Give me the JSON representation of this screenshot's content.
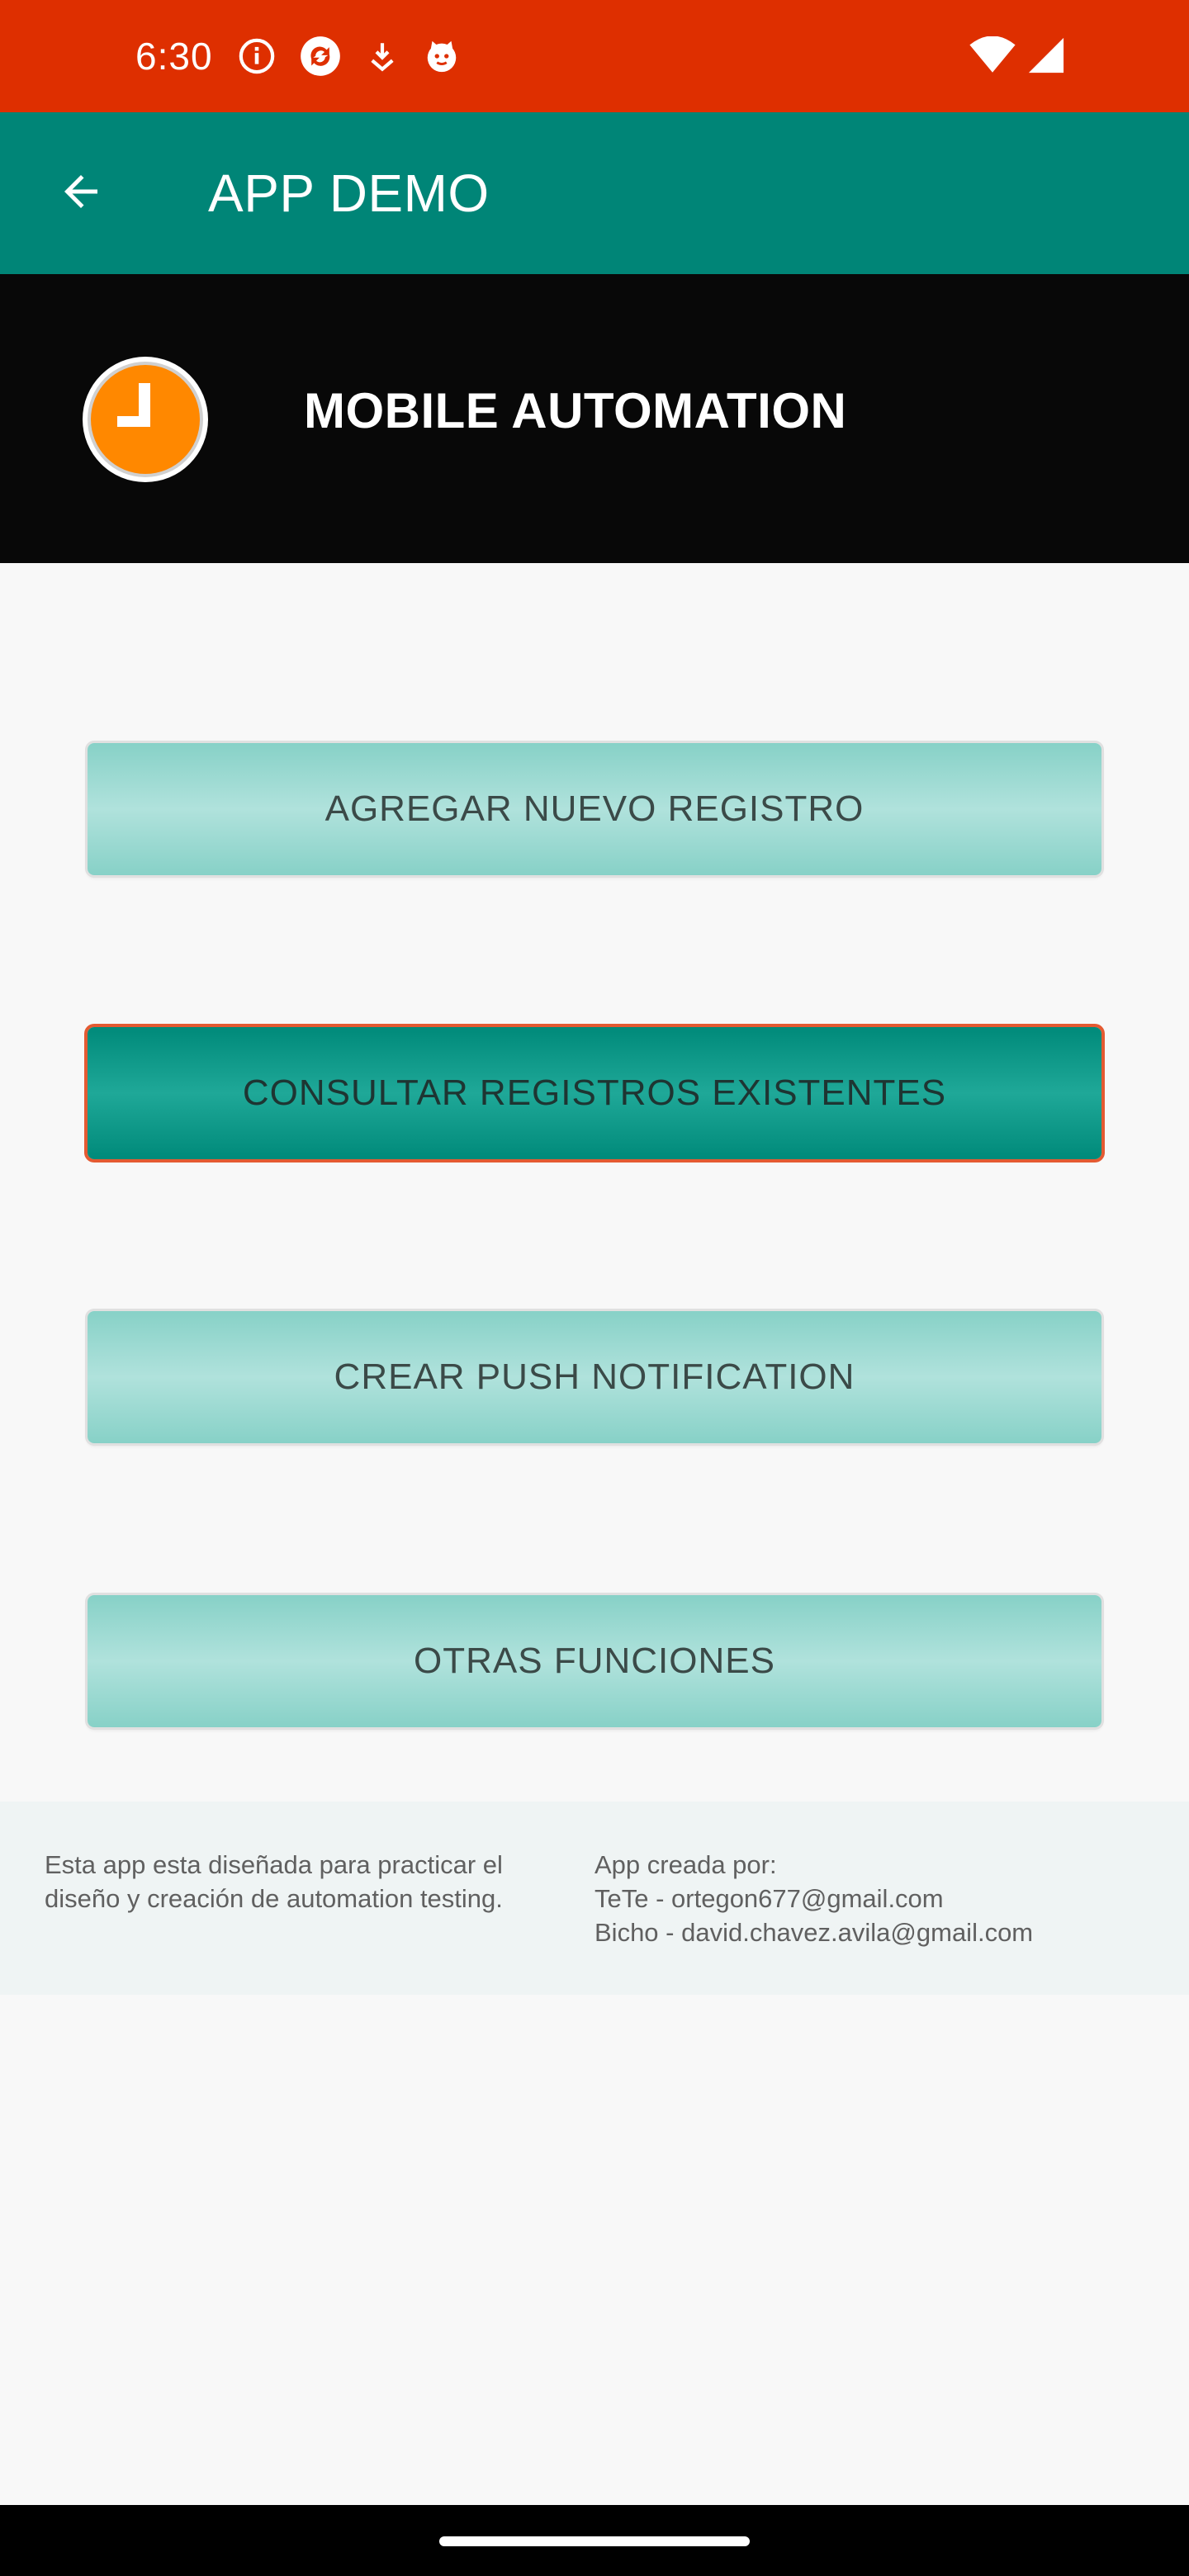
{
  "status_bar": {
    "time": "6:30",
    "left_icons": [
      "info-icon",
      "sync-icon",
      "download-icon",
      "cat-icon"
    ],
    "right_icons": [
      "wifi-icon",
      "signal-icon"
    ]
  },
  "app_bar": {
    "back_icon": "arrow-back-icon",
    "title": "APP DEMO",
    "color": "#008577"
  },
  "header": {
    "logo_icon": "clock-icon",
    "title": "MOBILE AUTOMATION",
    "logo_color": "#ff8800"
  },
  "menu": {
    "buttons": [
      {
        "label": "AGREGAR NUEVO REGISTRO",
        "state": "normal"
      },
      {
        "label": "CONSULTAR REGISTROS EXISTENTES",
        "state": "pressed"
      },
      {
        "label": "CREAR PUSH NOTIFICATION",
        "state": "normal"
      },
      {
        "label": "OTRAS FUNCIONES",
        "state": "normal"
      }
    ],
    "button_color": "#b0e2dc",
    "pressed_color": "#008a7a",
    "pressed_border_color": "#e45a32"
  },
  "footer": {
    "description": "Esta app esta diseñada para practicar el diseño y creación de automation testing.",
    "credits_title": "App creada por:",
    "credits": [
      "TeTe - ortegon677@gmail.com",
      "Bicho - david.chavez.avila@gmail.com"
    ]
  },
  "colors": {
    "status_bar": "#de2f00",
    "header_bg": "#080808",
    "page_bg": "#f8f8f8"
  }
}
